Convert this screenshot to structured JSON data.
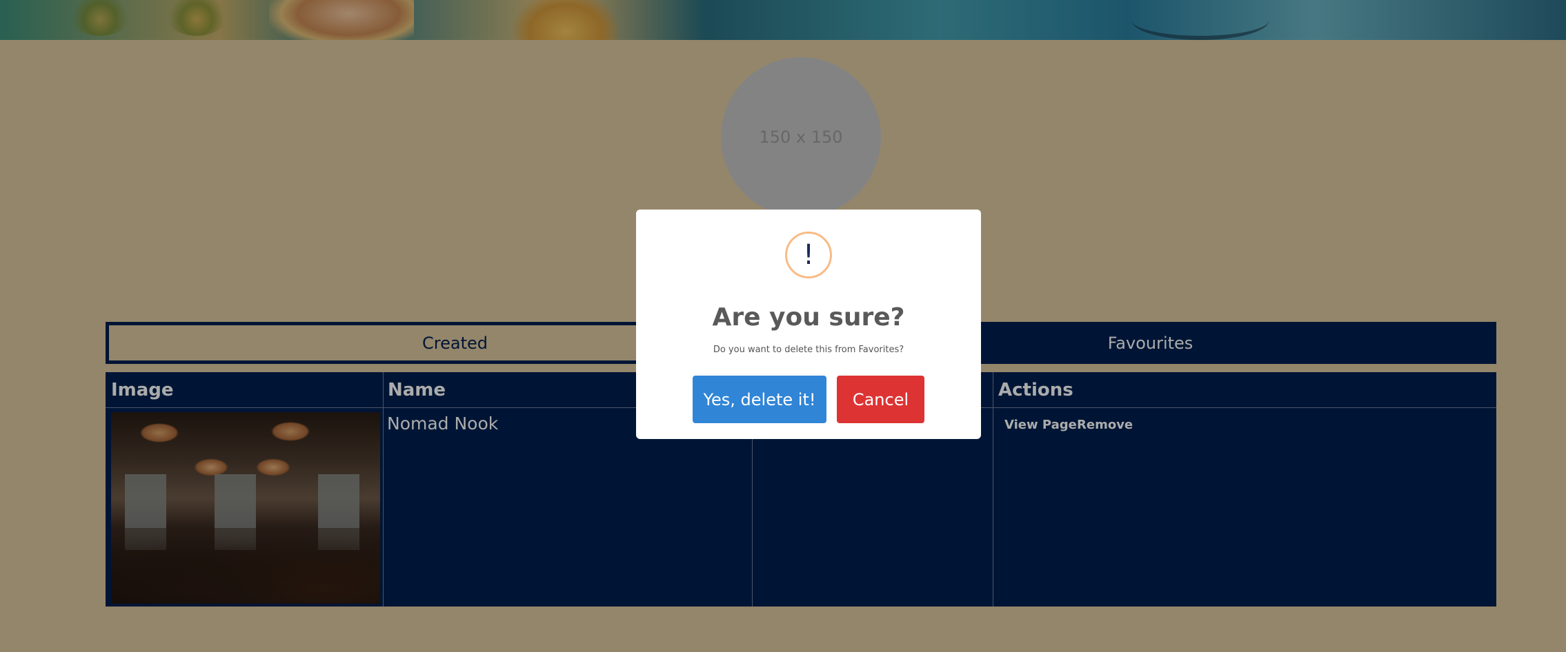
{
  "avatar": {
    "placeholder_text": "150 x 150"
  },
  "tabs": [
    {
      "label": "Created",
      "active": true
    },
    {
      "label": "Favourites",
      "active": false
    }
  ],
  "table": {
    "headers": [
      "Image",
      "Name",
      "Actions"
    ],
    "rows": [
      {
        "name": "Nomad Nook",
        "actions": [
          "View Page",
          "Remove"
        ]
      }
    ]
  },
  "modal": {
    "icon": "!",
    "title": "Are you sure?",
    "text": "Do you want to delete this from Favorites?",
    "confirm_label": "Yes, delete it!",
    "cancel_label": "Cancel"
  },
  "colors": {
    "page_background": "#ddc8a0",
    "navy": "#002050",
    "confirm_button": "#3085d6",
    "cancel_button": "#dd3333",
    "warning_icon_ring": "#f8bb86"
  }
}
